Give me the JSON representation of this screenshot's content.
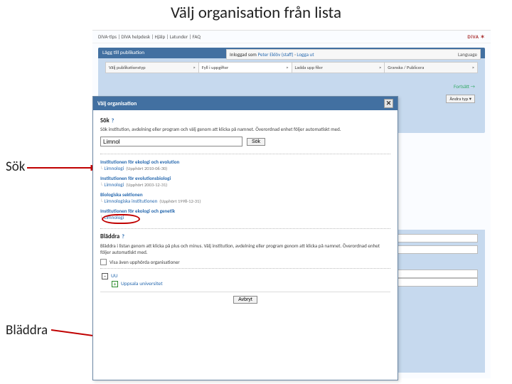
{
  "page_title": "Välj organisation från lista",
  "labels": {
    "sok": "Sök",
    "bladdra": "Bläddra"
  },
  "topbar": {
    "links": [
      "DiVA-tips",
      "DiVA helpdesk",
      "Hjälp",
      "Latunder",
      "FAQ"
    ],
    "logo": "DiVA"
  },
  "header": {
    "tab_title": "Lägg till publikation",
    "logged_in_prefix": "Inloggad som",
    "user": "Peter Eklöv (staff)",
    "logout": "Logga ut",
    "language_label": "Language"
  },
  "steps": [
    {
      "label": "Välj publikationstyp"
    },
    {
      "label": "Fyll i uppgifter",
      "current": true
    },
    {
      "label": "Ladda upp filer"
    },
    {
      "label": "Granska / Publicera"
    }
  ],
  "side": {
    "fortsatt": "Fortsätt →",
    "andra_typ": "Ändra typ ▾"
  },
  "modal": {
    "title": "Välj organisation",
    "search_heading": "Sök",
    "search_hint": "Sök institution, avdelning eller program och välj genom att klicka på namnet. Överordnad enhet följer automatiskt med.",
    "search_value": "Limnol",
    "search_btn": "Sök",
    "results": [
      {
        "parent": "Institutionen för ekologi och evolution",
        "child": "Limnologi",
        "meta": "(Upphört 2010-06-30)"
      },
      {
        "parent": "Institutionen för evolutionsbiologi",
        "child": "Limnologi",
        "meta": "(Upphört 2003-12-31)"
      },
      {
        "parent": "Biologiska sektionen",
        "child": "Limnologiska institutionen",
        "meta": "(Upphört 1998-12-31)"
      },
      {
        "parent": "Institutionen för ekologi och genetik",
        "child": "Limnologi",
        "meta": ""
      }
    ],
    "browse_heading": "Bläddra",
    "browse_hint": "Bläddra i listan genom att klicka på plus och minus. Välj institution, avdelning eller program genom att klicka på namnet. Överordnad enhet följer automatiskt med.",
    "chk_label": "Visa även upphörda organisationer",
    "tree": {
      "root": "UU",
      "child": "Uppsala universitet"
    },
    "cancel": "Avbryt"
  }
}
